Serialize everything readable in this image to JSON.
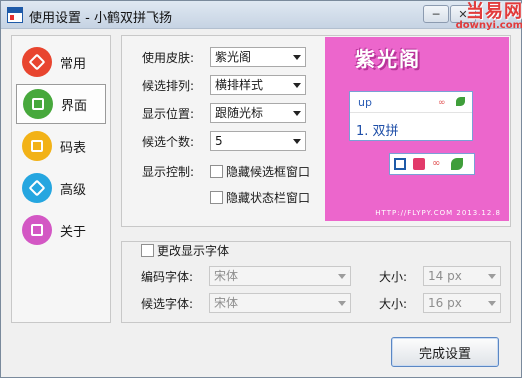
{
  "window": {
    "title": "使用设置 - 小鹤双拼飞扬"
  },
  "title_buttons": {
    "minimize": "─",
    "close": "✕"
  },
  "watermark": {
    "top": "当易网",
    "bottom": "downyi.com"
  },
  "nav": {
    "items": [
      {
        "label": "常用",
        "color": "#e8452f",
        "active": false
      },
      {
        "label": "界面",
        "color": "#47a83c",
        "active": true
      },
      {
        "label": "码表",
        "color": "#f2b217",
        "active": false
      },
      {
        "label": "高级",
        "color": "#25a6e0",
        "active": false
      },
      {
        "label": "关于",
        "color": "#d357c4",
        "active": false
      }
    ]
  },
  "settings": {
    "skin_label": "使用皮肤:",
    "skin_value": "紫光阁",
    "order_label": "候选排列:",
    "order_value": "横排样式",
    "position_label": "显示位置:",
    "position_value": "跟随光标",
    "count_label": "候选个数:",
    "count_value": "5",
    "control_label": "显示控制:",
    "hide_candidate_label": "隐藏候选框窗口",
    "hide_status_label": "隐藏状态栏窗口"
  },
  "preview": {
    "title": "紫光阁",
    "code": "up",
    "candidate": "1. 双拼",
    "footer": "HTTP://FLYPY.COM 2013.12.8",
    "bg_color": "#ec66cc"
  },
  "font": {
    "change_label": "更改显示字体",
    "code_font_label": "编码字体:",
    "code_font_value": "宋体",
    "cand_font_label": "候选字体:",
    "cand_font_value": "宋体",
    "size_label": "大小:",
    "code_size_value": "14 px",
    "cand_size_value": "16 px"
  },
  "finish_button": "完成设置"
}
